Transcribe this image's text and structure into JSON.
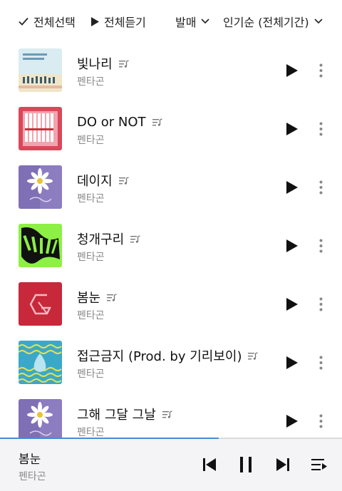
{
  "toolbar": {
    "select_all_label": "전체선택",
    "play_all_label": "전체듣기",
    "release_label": "발매",
    "sort_label": "인기순 (전체기간)"
  },
  "songs": [
    {
      "title": "빛나리",
      "artist": "펜타곤",
      "cover": "positive-album-cover"
    },
    {
      "title": "DO or NOT",
      "artist": "펜타곤",
      "cover": "pink-album-cover"
    },
    {
      "title": "데이지",
      "artist": "펜타곤",
      "cover": "daisy-album-cover"
    },
    {
      "title": "청개구리",
      "artist": "펜타곤",
      "cover": "thumbs-up-album-cover"
    },
    {
      "title": "봄눈",
      "artist": "펜타곤",
      "cover": "red-logo-album-cover"
    },
    {
      "title": "접근금지 (Prod. by 기리보이)",
      "artist": "펜타곤",
      "cover": "wave-album-cover"
    },
    {
      "title": "그해 그달 그날",
      "artist": "펜타곤",
      "cover": "daisy-album-cover"
    }
  ],
  "player": {
    "title": "봄눈",
    "artist": "펜타곤",
    "progress": 0.64
  },
  "colors": {
    "accent": "#4a8ad8",
    "artist_text": "#8a8a8a",
    "player_bg": "#f4f4f6"
  },
  "icons": {
    "select_all": "check-icon",
    "play_all": "play-icon",
    "dropdown": "chevron-down-icon",
    "lyrics": "lyrics-icon",
    "row_play": "play-icon",
    "row_more": "more-vertical-icon",
    "prev": "skip-previous-icon",
    "pause": "pause-icon",
    "next": "skip-next-icon",
    "queue": "playlist-icon"
  }
}
